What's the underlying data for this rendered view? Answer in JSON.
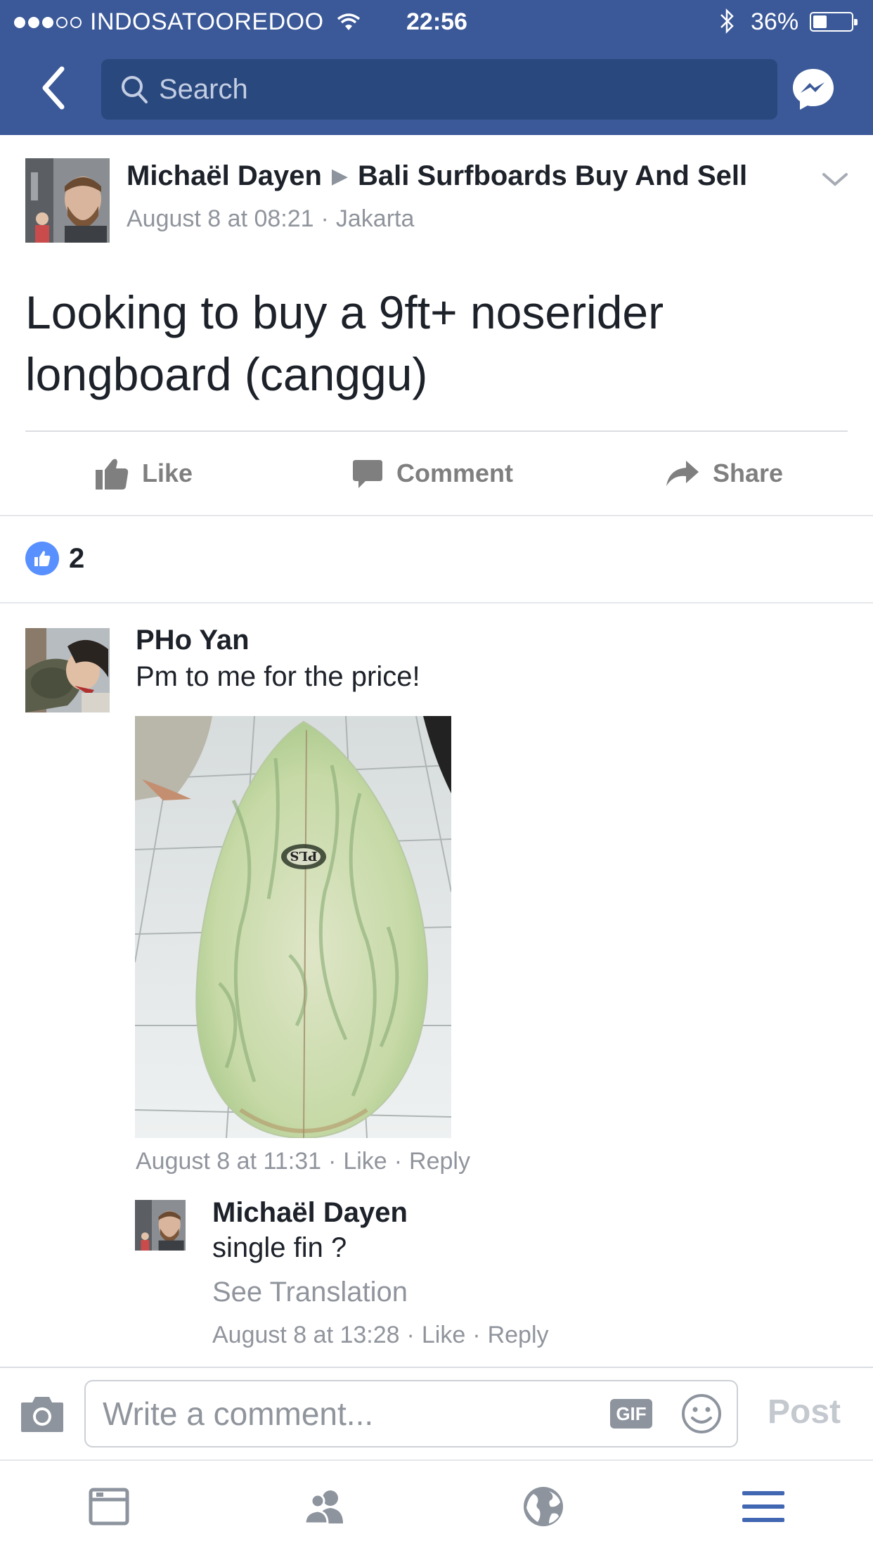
{
  "status_bar": {
    "carrier": "INDOSATOOREDOO",
    "time": "22:56",
    "battery_percent_label": "36%",
    "battery_level": 0.36
  },
  "header": {
    "search_placeholder": "Search",
    "icons": [
      "back-icon",
      "search-icon",
      "messenger-icon"
    ],
    "background_color": "#3b5998"
  },
  "post": {
    "author": "Michaël Dayen",
    "group": "Bali Surfboards Buy And Sell",
    "date": "August 8 at 08:21",
    "separator": "·",
    "location": "Jakarta",
    "body": "Looking to buy  a 9ft+ noserider longboard (canggu)",
    "actions": {
      "like": "Like",
      "comment": "Comment",
      "share": "Share"
    },
    "reaction_count": "2"
  },
  "comments": [
    {
      "author": "PHo Yan",
      "text": "Pm to me for the price!",
      "has_image": true,
      "image_logo_text": "PLS",
      "date": "August 8 at 11:31",
      "like_label": "Like",
      "reply_label": "Reply"
    },
    {
      "author": "Michaël Dayen",
      "text": "single fin ?",
      "see_translation": "See Translation",
      "date": "August 8 at 13:28",
      "like_label": "Like",
      "reply_label": "Reply"
    }
  ],
  "composer": {
    "placeholder": "Write a comment...",
    "gif_label": "GIF",
    "post_label": "Post"
  },
  "tab_bar": {
    "tabs": [
      "feed-icon",
      "friends-icon",
      "globe-icon",
      "menu-icon"
    ],
    "active_color": "#4267b2"
  }
}
